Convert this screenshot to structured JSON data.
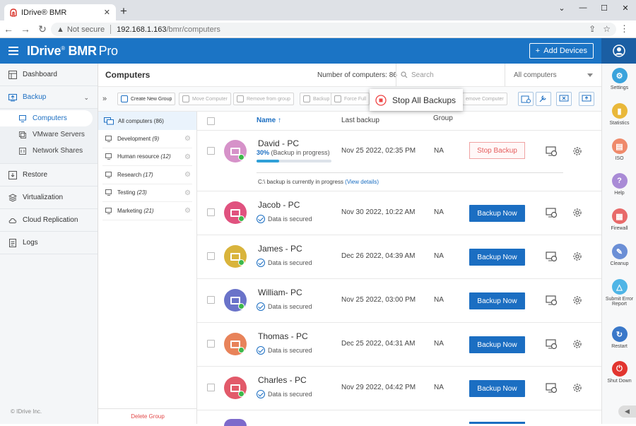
{
  "browser": {
    "tab_title": "IDrive® BMR",
    "not_secure": "Not secure",
    "url_host": "192.168.1.163",
    "url_path": "/bmr/computers"
  },
  "header": {
    "brand": "IDrive",
    "brand_reg": "®",
    "brand_suffix": "BMR",
    "brand_pro": "Pro",
    "add_devices": "Add Devices"
  },
  "sidebar": {
    "items": [
      {
        "label": "Dashboard"
      },
      {
        "label": "Backup"
      },
      {
        "label": "Restore"
      },
      {
        "label": "Virtualization"
      },
      {
        "label": "Cloud Replication"
      },
      {
        "label": "Logs"
      }
    ],
    "backup_sub": [
      {
        "label": "Computers"
      },
      {
        "label": "VMware Servers"
      },
      {
        "label": "Network Shares"
      }
    ],
    "copyright": "© IDrive Inc."
  },
  "main": {
    "title": "Computers",
    "count_label": "Number of computers: 86",
    "search_placeholder": "Search",
    "filter_value": "All computers"
  },
  "toolbar": {
    "create_group": "Create New Group",
    "move_computer": "Move Computer",
    "remove_from_group": "Remove from group",
    "backup": "Backup",
    "force_full": "Force Full",
    "remove_computer": "emove Computer",
    "tooltip": "Stop All Backups"
  },
  "groups": {
    "all": "All computers (86)",
    "items": [
      {
        "name": "Development",
        "count": "(9)"
      },
      {
        "name": "Human resource",
        "count": "(12)"
      },
      {
        "name": "Research",
        "count": "(17)"
      },
      {
        "name": "Testing",
        "count": "(23)"
      },
      {
        "name": "Marketing",
        "count": "(21)"
      }
    ],
    "delete_label": "Delete Group"
  },
  "table": {
    "col_name": "Name",
    "col_last": "Last backup",
    "col_group": "Group",
    "rows": [
      {
        "name": "David - PC",
        "progress_pct": "30%",
        "progress_text": "(Backup in progress)",
        "progress": 0.3,
        "date": "Nov 25 2022, 02:35 PM",
        "group": "NA",
        "action": "Stop Backup",
        "message": "C:\\ backup is currently in progress",
        "details": "(View details)",
        "avatar_color": "#d692c9"
      },
      {
        "name": "Jacob - PC",
        "status": "Data is secured",
        "date": "Nov 30 2022, 10:22 AM",
        "group": "NA",
        "action": "Backup Now",
        "avatar_color": "#e0527f"
      },
      {
        "name": "James - PC",
        "status": "Data is secured",
        "date": "Dec 26 2022, 04:39 AM",
        "group": "NA",
        "action": "Backup Now",
        "avatar_color": "#d9b43c"
      },
      {
        "name": "William- PC",
        "status": "Data is secured",
        "date": "Nov 25 2022, 03:00 PM",
        "group": "NA",
        "action": "Backup Now",
        "avatar_color": "#6a73c9"
      },
      {
        "name": "Thomas - PC",
        "status": "Data is secured",
        "date": "Dec 25 2022, 04:31 AM",
        "group": "NA",
        "action": "Backup Now",
        "avatar_color": "#e8835a"
      },
      {
        "name": "Charles - PC",
        "status": "Data is secured",
        "date": "Nov 29 2022, 04:42 PM",
        "group": "NA",
        "action": "Backup Now",
        "avatar_color": "#e25a6a"
      }
    ]
  },
  "right_panel": {
    "items": [
      {
        "label": "Settings",
        "color": "#3aa3dc",
        "icon": "gear-icon"
      },
      {
        "label": "Statistics",
        "color": "#e9b83a",
        "icon": "chart-icon"
      },
      {
        "label": "ISO",
        "color": "#ef8a6b",
        "icon": "file-icon"
      },
      {
        "label": "Help",
        "color": "#a98bd6",
        "icon": "question-icon"
      },
      {
        "label": "Firewall",
        "color": "#e86a6a",
        "icon": "firewall-icon"
      },
      {
        "label": "Cleanup",
        "color": "#6b8fd6",
        "icon": "broom-icon"
      },
      {
        "label": "Submit Error Report",
        "color": "#4fb5e6",
        "icon": "warning-icon"
      },
      {
        "label": "Restart",
        "color": "#3a78c9",
        "icon": "restart-icon"
      },
      {
        "label": "Shut Down",
        "color": "#e2352f",
        "icon": "power-icon"
      }
    ]
  }
}
